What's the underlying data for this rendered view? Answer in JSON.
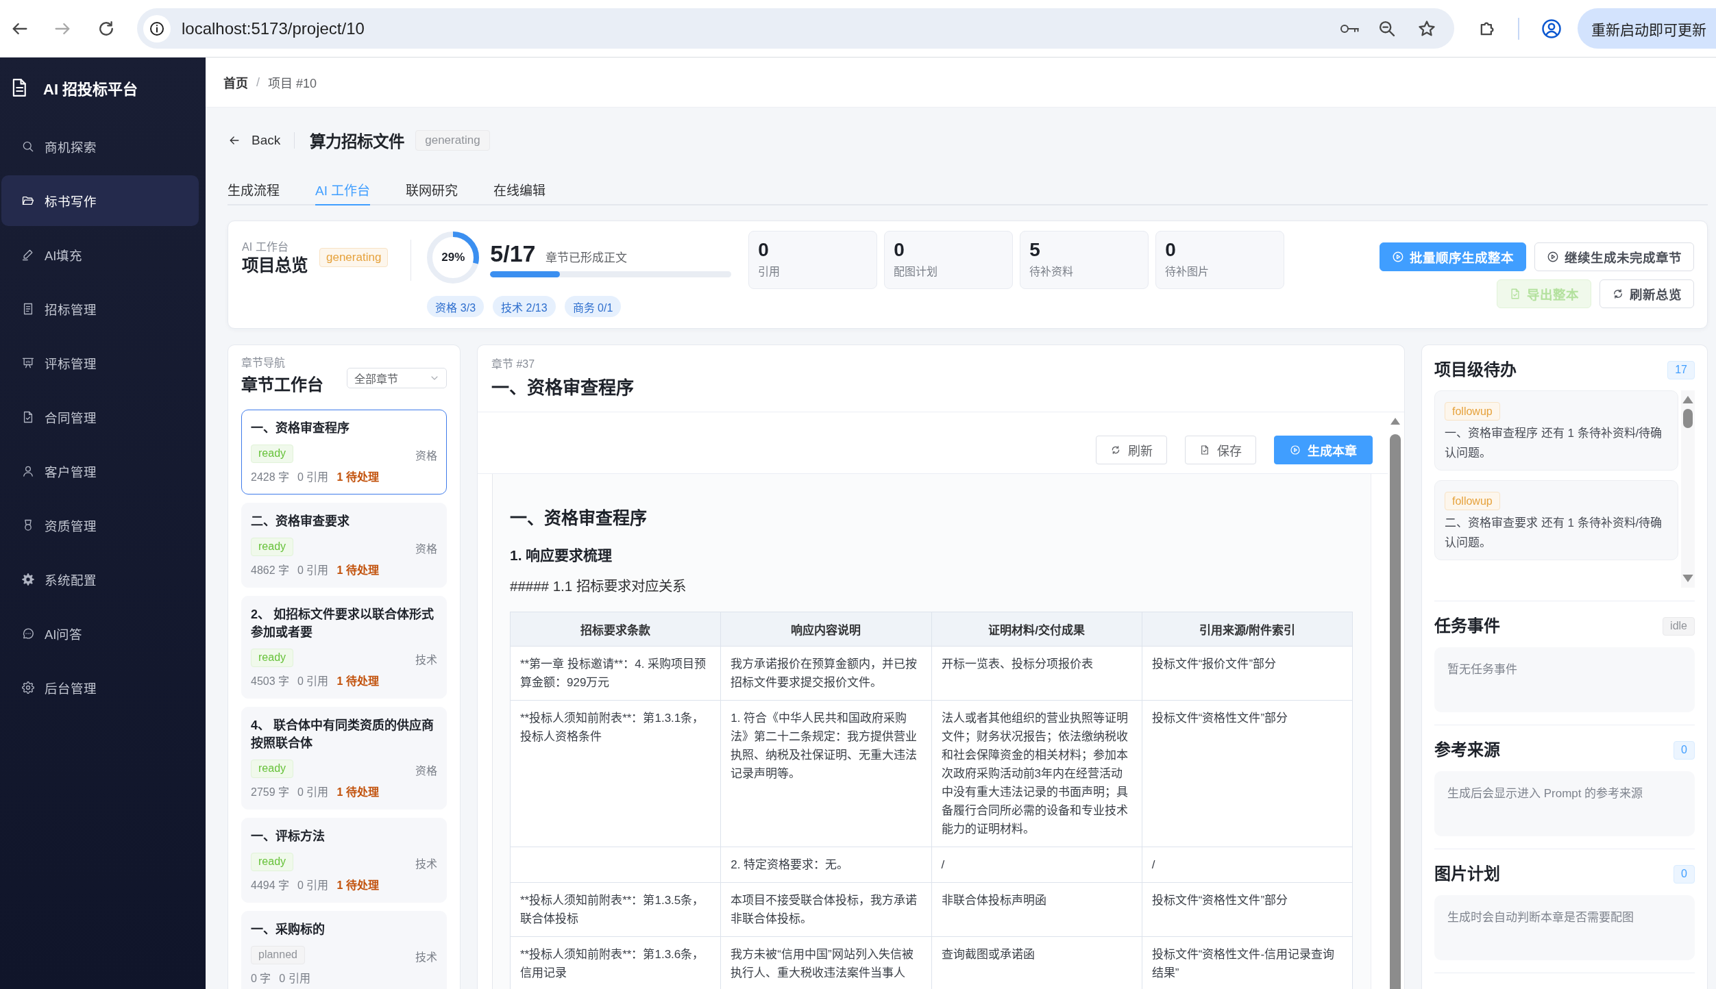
{
  "browser": {
    "url": "localhost:5173/project/10",
    "update_button": "重新启动即可更新"
  },
  "sidebar": {
    "brand": "AI 招投标平台",
    "items": [
      {
        "label": "商机探索",
        "selected": false
      },
      {
        "label": "标书写作",
        "selected": true
      },
      {
        "label": "AI填充",
        "selected": false
      },
      {
        "label": "招标管理",
        "selected": false
      },
      {
        "label": "评标管理",
        "selected": false
      },
      {
        "label": "合同管理",
        "selected": false
      },
      {
        "label": "客户管理",
        "selected": false
      },
      {
        "label": "资质管理",
        "selected": false
      },
      {
        "label": "系统配置",
        "selected": false
      },
      {
        "label": "AI问答",
        "selected": false
      },
      {
        "label": "后台管理",
        "selected": false
      }
    ]
  },
  "breadcrumb": {
    "separator": "/",
    "items": [
      {
        "label": "首页",
        "current": false
      },
      {
        "label": "项目 #10",
        "current": true
      }
    ]
  },
  "page_header": {
    "back": "Back",
    "title": "算力招标文件",
    "status": {
      "label": "generating",
      "kind": "neutral"
    }
  },
  "tabs": [
    {
      "label": "生成流程",
      "selected": false
    },
    {
      "label": "AI 工作台",
      "selected": true
    },
    {
      "label": "联网研究",
      "selected": false
    },
    {
      "label": "在线编辑",
      "selected": false
    }
  ],
  "overview": {
    "eyebrow": "AI 工作台",
    "title": "项目总览",
    "status": {
      "label": "generating",
      "kind": "warning"
    },
    "ring": {
      "label": "29%",
      "level": 0.29
    },
    "progress": {
      "value": "5/17",
      "caption": "章节已形成正文",
      "level": 0.29
    },
    "chips": [
      "资格 3/3",
      "技术 2/13",
      "商务 0/1"
    ],
    "stats": [
      {
        "value": "0",
        "label": "引用"
      },
      {
        "value": "0",
        "label": "配图计划"
      },
      {
        "value": "5",
        "label": "待补资料"
      },
      {
        "value": "0",
        "label": "待补图片"
      }
    ],
    "buttons": [
      {
        "label": "批量顺序生成整本",
        "kind": "primary",
        "disabled": false
      },
      {
        "label": "继续生成未完成章节",
        "kind": "default",
        "disabled": false
      },
      {
        "label": "导出整本",
        "kind": "success",
        "disabled": true
      },
      {
        "label": "刷新总览",
        "kind": "default",
        "disabled": false
      }
    ]
  },
  "chapters": {
    "eyebrow": "章节导航",
    "title": "章节工作台",
    "filter": "全部章节",
    "items": [
      {
        "title": "一、资格审查程序",
        "status": {
          "label": "ready",
          "kind": "success"
        },
        "category": "资格",
        "words": "2428 字",
        "refs": "0 引用",
        "pending": "1 待处理",
        "selected": true
      },
      {
        "title": "二、资格审查要求",
        "status": {
          "label": "ready",
          "kind": "success"
        },
        "category": "资格",
        "words": "4862 字",
        "refs": "0 引用",
        "pending": "1 待处理",
        "selected": false
      },
      {
        "title": "2、 如招标文件要求以联合体形式参加或者要",
        "status": {
          "label": "ready",
          "kind": "success"
        },
        "category": "技术",
        "words": "4503 字",
        "refs": "0 引用",
        "pending": "1 待处理",
        "selected": false
      },
      {
        "title": "4、 联合体中有同类资质的供应商按照联合体",
        "status": {
          "label": "ready",
          "kind": "success"
        },
        "category": "资格",
        "words": "2759 字",
        "refs": "0 引用",
        "pending": "1 待处理",
        "selected": false
      },
      {
        "title": "一、评标方法",
        "status": {
          "label": "ready",
          "kind": "success"
        },
        "category": "技术",
        "words": "4494 字",
        "refs": "0 引用",
        "pending": "1 待处理",
        "selected": false
      },
      {
        "title": "一、采购标的",
        "status": {
          "label": "planned",
          "kind": "neutral"
        },
        "category": "技术",
        "words": "0 字",
        "refs": "0 引用",
        "selected": false
      }
    ]
  },
  "editor": {
    "eyebrow": "章节 #37",
    "title": "一、资格审查程序",
    "buttons": [
      {
        "label": "刷新",
        "kind": "default"
      },
      {
        "label": "保存",
        "kind": "default"
      },
      {
        "label": "生成本章",
        "kind": "primary"
      }
    ],
    "document": {
      "heading": "一、资格审查程序",
      "subheading": "1. 响应要求梳理",
      "paragraph": "##### 1.1 招标要求对应关系",
      "table": {
        "columns": [
          "招标要求条款",
          "响应内容说明",
          "证明材料/交付成果",
          "引用来源/附件索引"
        ],
        "rows": [
          {
            "clause": "**第一章 投标邀请**：4. 采购项目预算金额：929万元",
            "response": "我方承诺报价在预算金额内，并已按招标文件要求提交报价文件。",
            "evidence": "开标一览表、投标分项报价表",
            "source": "投标文件“报价文件”部分"
          },
          {
            "clause": "**投标人须知前附表**：第1.3.1条，投标人资格条件",
            "response": "1. 符合《中华人民共和国政府采购法》第二十二条规定：我方提供营业执照、纳税及社保证明、无重大违法记录声明等。",
            "evidence": "法人或者其他组织的营业执照等证明文件；财务状况报告；依法缴纳税收和社会保障资金的相关材料；参加本次政府采购活动前3年内在经营活动中没有重大违法记录的书面声明；具备履行合同所必需的设备和专业技术能力的证明材料。",
            "source": "投标文件“资格性文件”部分"
          },
          {
            "response": "2. 特定资格要求：无。",
            "evidence": "/",
            "source": "/"
          },
          {
            "clause": "**投标人须知前附表**：第1.3.5条，联合体投标",
            "response": "本项目不接受联合体投标，我方承诺非联合体投标。",
            "evidence": "非联合体投标声明函",
            "source": "投标文件“资格性文件”部分"
          },
          {
            "clause": "**投标人须知前附表**：第1.3.6条，信用记录",
            "response": "我方未被“信用中国”网站列入失信被执行人、重大税收违法案件当事人",
            "evidence": "查询截图或承诺函",
            "source": "投标文件“资格性文件-信用记录查询结果”"
          }
        ]
      }
    }
  },
  "side_panel": {
    "sections": [
      {
        "kind": "list",
        "title": "项目级待办",
        "badge": {
          "label": "17",
          "kind": "info"
        },
        "items": [
          {
            "tag": {
              "label": "followup",
              "kind": "warning"
            },
            "text": "一、资格审查程序 还有 1 条待补资料/待确认问题。"
          },
          {
            "tag": {
              "label": "followup",
              "kind": "warning"
            },
            "text": "二、资格审查要求 还有 1 条待补资料/待确认问题。"
          }
        ]
      },
      {
        "kind": "empty",
        "title": "任务事件",
        "badge": {
          "label": "idle",
          "kind": "neutral"
        },
        "text": "暂无任务事件"
      },
      {
        "kind": "empty",
        "title": "参考来源",
        "badge": {
          "label": "0",
          "kind": "info"
        },
        "text": "生成后会显示进入 Prompt 的参考来源"
      },
      {
        "kind": "empty",
        "title": "图片计划",
        "badge": {
          "label": "0",
          "kind": "info"
        },
        "text": "生成时会自动判断本章是否需要配图"
      }
    ]
  }
}
